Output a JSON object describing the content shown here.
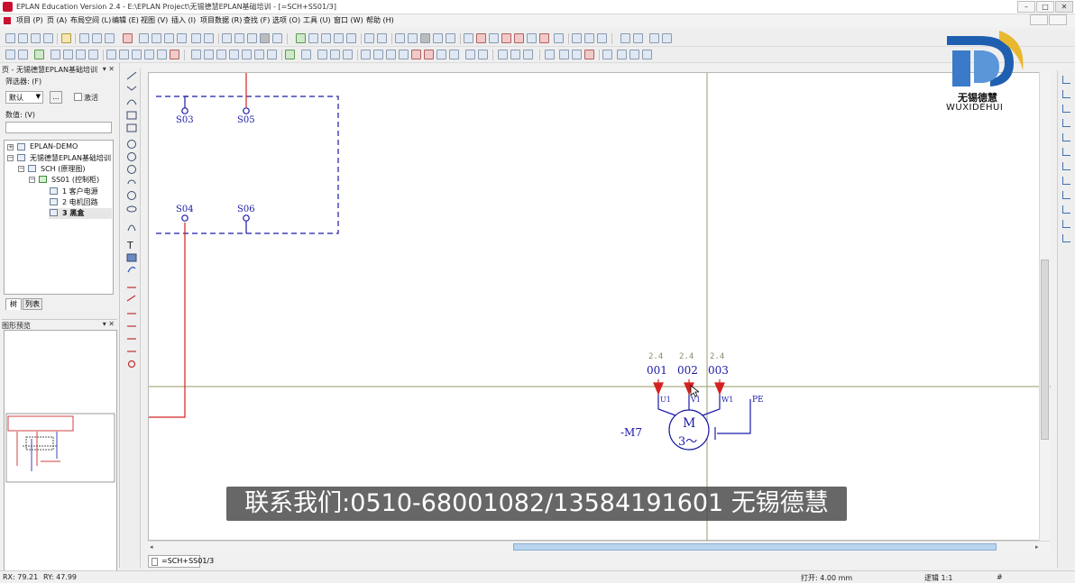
{
  "window": {
    "title": "EPLAN Education Version 2.4 - E:\\EPLAN Project\\无锡德慧EPLAN基础培训 - [=SCH+SS01/3]",
    "minimize": "–",
    "maximize": "□",
    "close": "✕"
  },
  "menu": [
    "项目 (P)",
    "页 (A)",
    "布局空间 (L)",
    "编辑 (E)",
    "视图 (V)",
    "插入 (I)",
    "项目数据 (R)",
    "查找 (F)",
    "选项 (O)",
    "工具 (U)",
    "窗口 (W)",
    "帮助 (H)"
  ],
  "page_navigator": {
    "header": "页 - 无锡德慧EPLAN基础培训",
    "filter_label": "筛选器: (F)",
    "filter_value": "默认",
    "filter_button": "...",
    "activate_label": "激活",
    "value_label": "数值: (V)",
    "tree": [
      {
        "label": "EPLAN-DEMO",
        "toggle": "+"
      },
      {
        "label": "无锡德慧EPLAN基础培训",
        "toggle": "−"
      },
      {
        "label": "SCH (原理图)",
        "toggle": "−"
      },
      {
        "label": "SS01 (控制柜)",
        "toggle": "−"
      },
      {
        "label": "1 客户电源",
        "toggle": ""
      },
      {
        "label": "2 电机回路",
        "toggle": ""
      },
      {
        "label": "3 黑盒",
        "toggle": ""
      }
    ],
    "selected_index": 6,
    "tabs": [
      "树",
      "列表"
    ]
  },
  "graphic_preview": {
    "header": "图形预览"
  },
  "schematic": {
    "terminals": [
      "S03",
      "S05",
      "S04",
      "S06"
    ],
    "motor": {
      "tag": "-M7",
      "symbol": "M",
      "phase": "3～",
      "cross_refs": [
        "2.4",
        "2.4",
        "2.4"
      ],
      "wires": [
        "001",
        "002",
        "003"
      ],
      "pins": [
        "U1",
        "V1",
        "W1",
        "PE"
      ]
    }
  },
  "page_tab": "=SCH+SS01/3",
  "status": {
    "rx": "RX: 79.21",
    "ry": "RY: 47.99",
    "grid": "打开: 4.00 mm",
    "logic": "逻辑 1:1",
    "hash": "#"
  },
  "subtitle": "联系我们:0510-68001082/13584191601 无锡德慧",
  "logo": {
    "cn": "无锡德慧",
    "en": "WUXIDEHUI"
  },
  "colors": {
    "wire_red": "#d42020",
    "schematic_blue": "#1a1aa8",
    "crossref_gray": "#8a8a6a",
    "crosshair": "#9a9a6a",
    "logo_blue": "#1f5fb0",
    "logo_gold": "#e8b830"
  }
}
